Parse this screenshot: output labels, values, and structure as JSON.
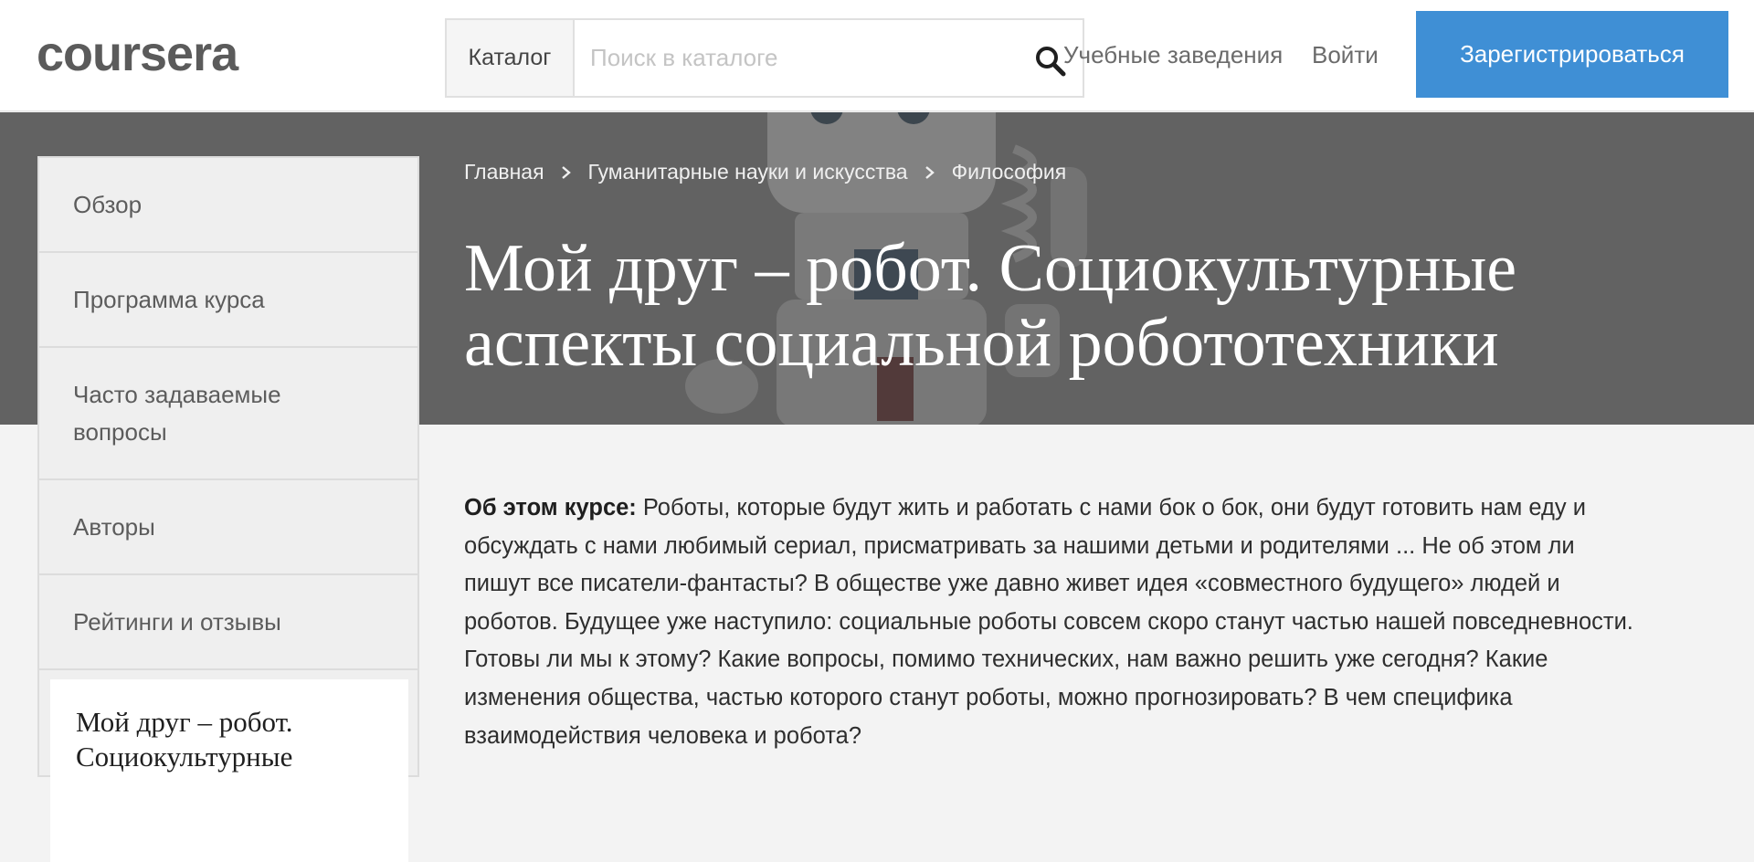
{
  "header": {
    "logo_text": "coursera",
    "catalog_label": "Каталог",
    "search_placeholder": "Поиск в каталоге",
    "nav": {
      "institutions": "Учебные заведения",
      "login": "Войти",
      "register": "Зарегистрироваться"
    }
  },
  "breadcrumb": [
    "Главная",
    "Гуманитарные науки и искусства",
    "Философия"
  ],
  "course": {
    "title_line1": "Мой друг – робот. Социокультурные",
    "title_line2": "аспекты социальной робототехники"
  },
  "sidebar": {
    "items": [
      {
        "label": "Обзор"
      },
      {
        "label": "Программа курса"
      },
      {
        "label_line1": "Часто задаваемые",
        "label_line2": "вопросы"
      },
      {
        "label": "Авторы"
      },
      {
        "label": "Рейтинги и отзывы"
      }
    ],
    "card_line1": "Мой друг – робот.",
    "card_line2": "Социокультурные"
  },
  "about": {
    "label": "Об этом курсе:",
    "line1": " Роботы, которые будут жить и работать с нами бок о бок, они будут готовить нам еду и",
    "line2": "обсуждать с нами любимый сериал, присматривать за нашими детьми и родителями ... Не об этом ли",
    "line3": "пишут все писатели-фантасты? В обществе уже давно живет идея «совместного будущего» людей и",
    "line4": "роботов. Будущее уже наступило: социальные роботы совсем скоро станут частью нашей повседневности.",
    "line5": "Готовы ли мы к этому? Какие вопросы, помимо технических, нам важно решить уже сегодня?  Какие",
    "line6": "изменения общества, частью которого станут роботы, можно прогнозировать? В чем специфика",
    "line7": "взаимодействия человека и робота?"
  },
  "colors": {
    "accent": "#3f8fd5",
    "hero_bg": "#6e6e6e",
    "page_bg": "#f3f3f3"
  }
}
